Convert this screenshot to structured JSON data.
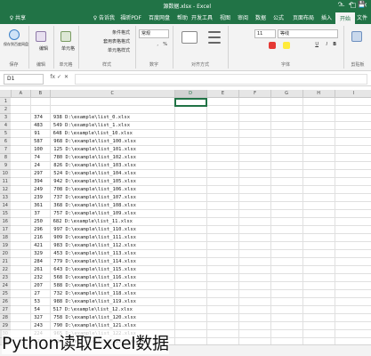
{
  "window": {
    "title": "源数据.xlsx - Excel",
    "controls": [
      "—",
      "□",
      "✕"
    ]
  },
  "quick_access": [
    "💾",
    "↶",
    "↷"
  ],
  "menu": {
    "tabs": [
      "文件",
      "开始",
      "插入",
      "页面布局",
      "公式",
      "数据",
      "审阅",
      "视图",
      "开发工具",
      "帮助",
      "百度网盘",
      "福昕PDF",
      "♀ 告诉我",
      "♀ 共享"
    ],
    "active_index": 1
  },
  "ribbon": {
    "groups": [
      "剪贴板",
      "字体",
      "对齐方式",
      "数字",
      "样式",
      "单元格",
      "编辑",
      "保存"
    ],
    "font_name": "等线",
    "font_size": "11",
    "number_format": "常规",
    "style_buttons": [
      "条件格式",
      "套用表格格式",
      "单元格样式"
    ],
    "cell_buttons": [
      "单元格"
    ],
    "edit_buttons": [
      "编辑"
    ],
    "save_buttons": [
      "保存到百度网盘"
    ]
  },
  "formula_bar": {
    "name_box": "D1",
    "fx": "fx",
    "cancel": "✕",
    "enter": "✓"
  },
  "grid": {
    "columns": [
      "A",
      "B",
      "C",
      "D",
      "E",
      "F",
      "G",
      "H",
      "I"
    ],
    "selected_column": "D",
    "rows": [
      "1",
      "2",
      "3",
      "4",
      "5",
      "6",
      "7",
      "8",
      "9",
      "10",
      "11",
      "12",
      "13",
      "14",
      "15",
      "16",
      "17",
      "18",
      "19",
      "20",
      "21",
      "22",
      "23",
      "24",
      "25",
      "26",
      "27",
      "28",
      "29",
      "30",
      "31",
      "32"
    ],
    "b_values": [
      "",
      "",
      "374",
      "483",
      "91",
      "587",
      "100",
      "74",
      "24",
      "297",
      "394",
      "249",
      "239",
      "361",
      "37",
      "250",
      "296",
      "216",
      "421",
      "329",
      "284",
      "261",
      "232",
      "207",
      "27",
      "53",
      "54",
      "327",
      "243",
      "224",
      "17",
      ""
    ],
    "c_values": [
      "",
      "",
      "938 D:\\example\\list_0.xlsx",
      "549 D:\\example\\list_1.xlsx",
      "648 D:\\example\\list_10.xlsx",
      "968 D:\\example\\list_100.xlsx",
      "125 D:\\example\\list_101.xlsx",
      "780 D:\\example\\list_102.xlsx",
      "826 D:\\example\\list_103.xlsx",
      "524 D:\\example\\list_104.xlsx",
      "942 D:\\example\\list_105.xlsx",
      "708 D:\\example\\list_106.xlsx",
      "737 D:\\example\\list_107.xlsx",
      "368 D:\\example\\list_108.xlsx",
      "757 D:\\example\\list_109.xlsx",
      "682 D:\\example\\list_11.xlsx",
      "997 D:\\example\\list_110.xlsx",
      "909 D:\\example\\list_111.xlsx",
      "983 D:\\example\\list_112.xlsx",
      "453 D:\\example\\list_113.xlsx",
      "779 D:\\example\\list_114.xlsx",
      "643 D:\\example\\list_115.xlsx",
      "568 D:\\example\\list_116.xlsx",
      "588 D:\\example\\list_117.xlsx",
      "732 D:\\example\\list_118.xlsx",
      "988 D:\\example\\list_119.xlsx",
      "517 D:\\example\\list_12.xlsx",
      "758 D:\\example\\list_120.xlsx",
      "790 D:\\example\\list_121.xlsx",
      "965 D:\\example\\list_122.xlsx",
      "313 D:\\example\\list_123.xlsx",
      ""
    ]
  },
  "caption": "Python读取Excel数据",
  "colors": {
    "excel_green": "#217346",
    "ribbon_bg": "#f3f3f3",
    "header_bg": "#e6e6e6"
  }
}
